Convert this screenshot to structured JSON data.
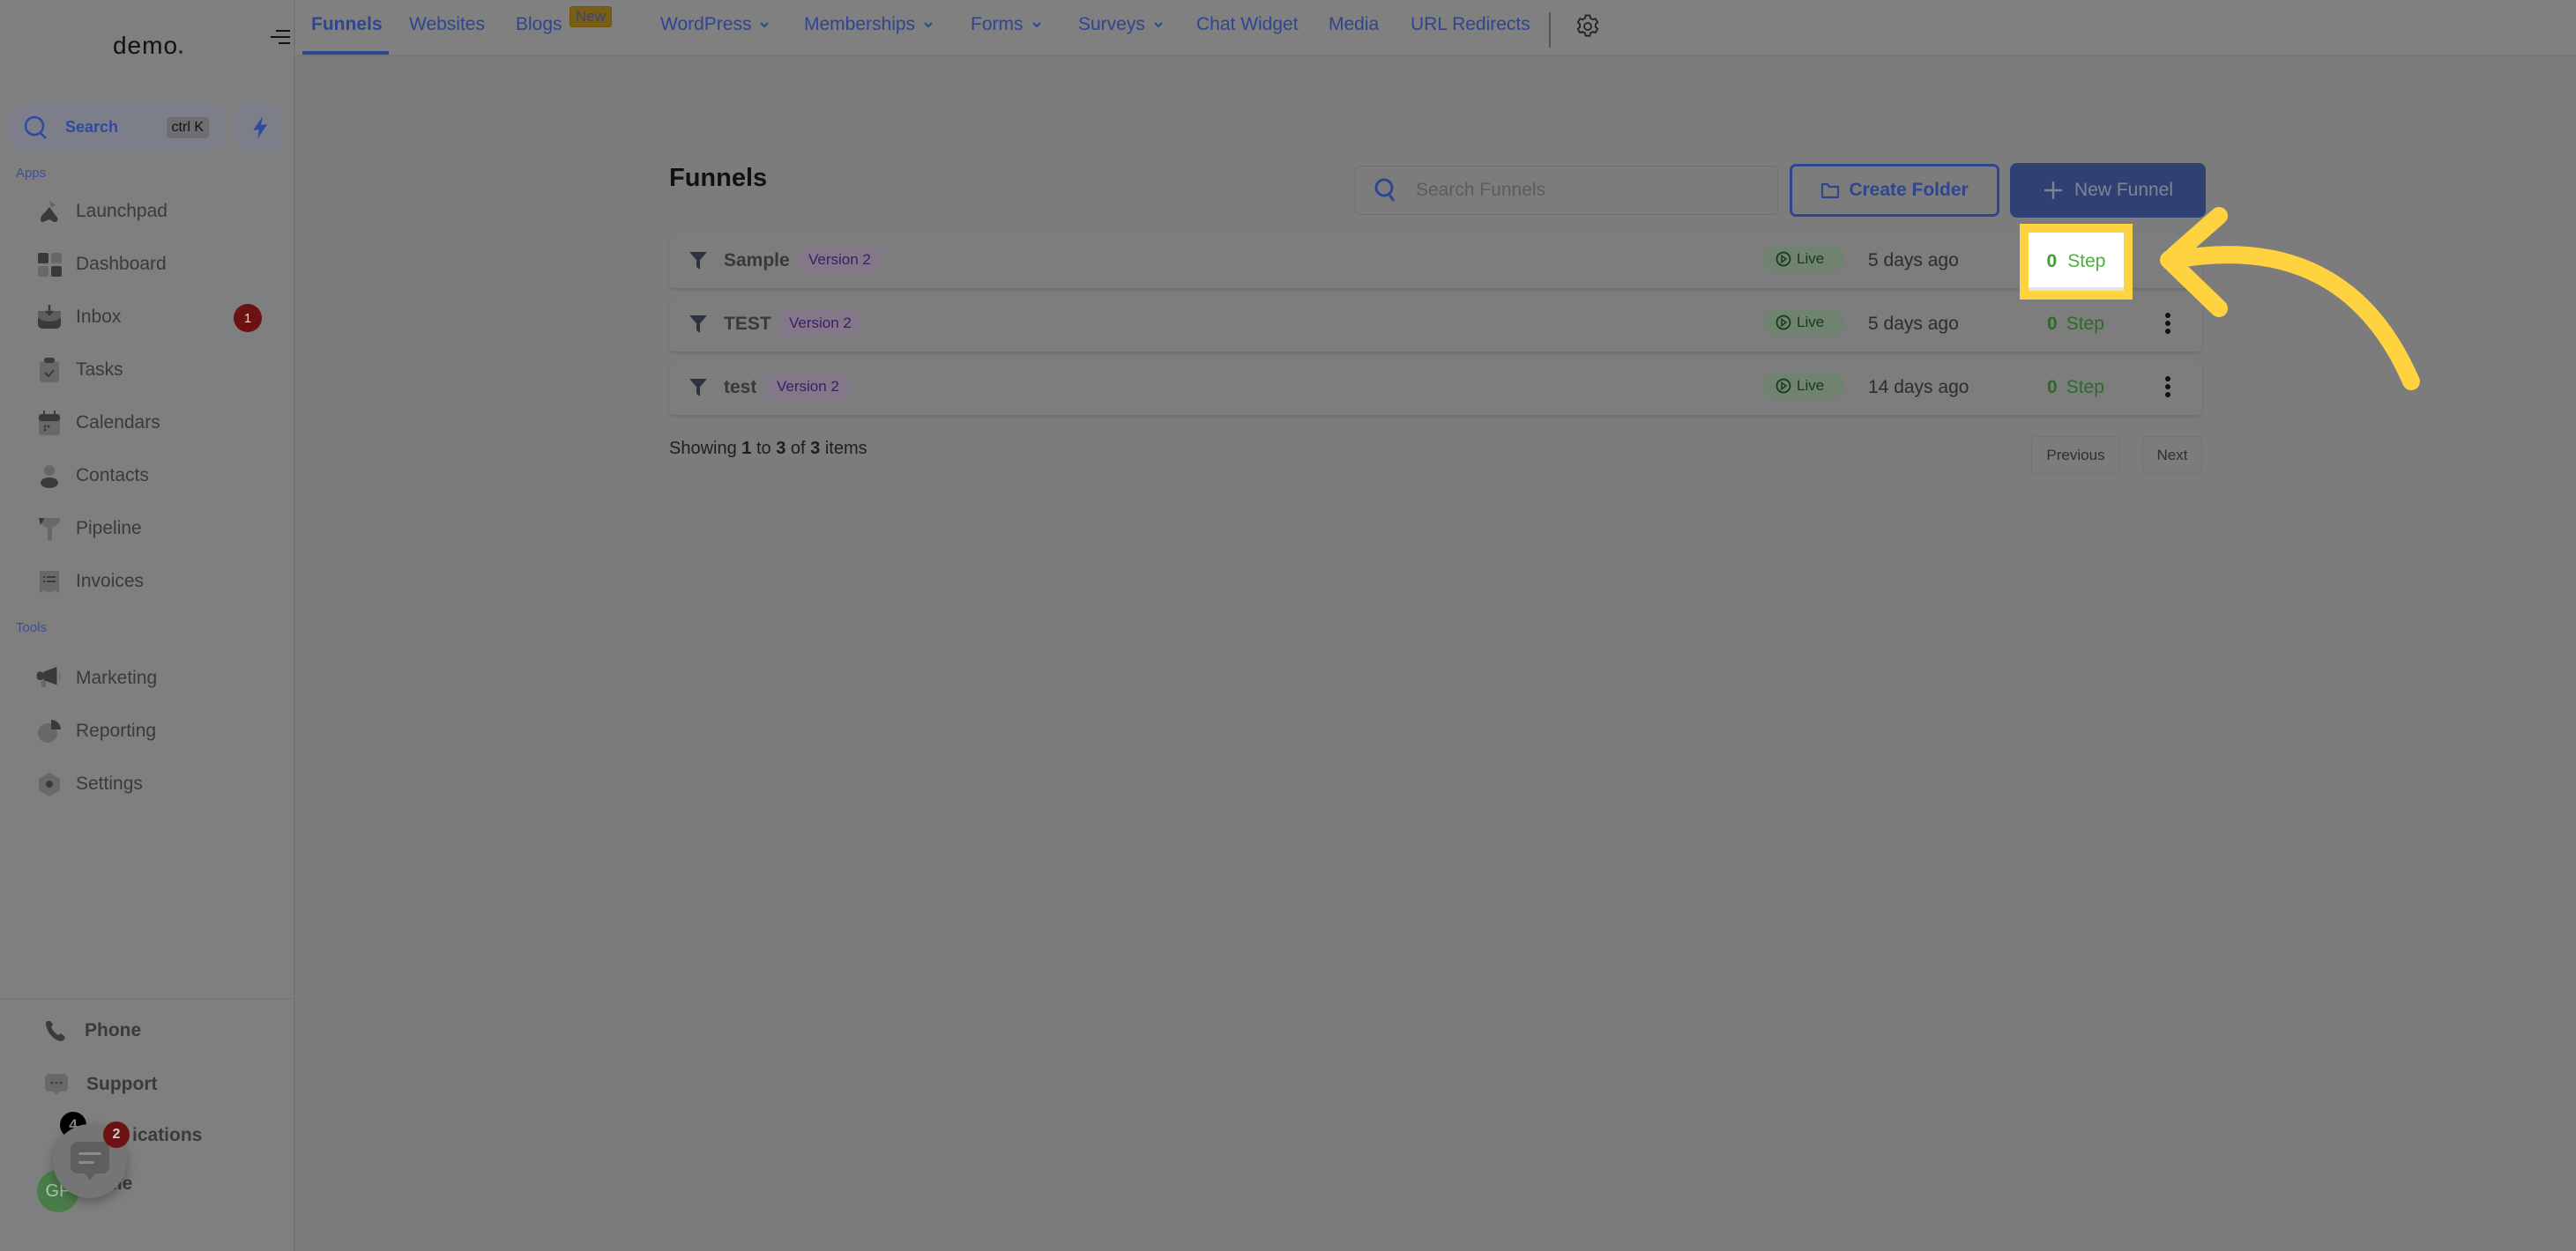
{
  "sidebar": {
    "logo": "demo",
    "search": {
      "label": "Search",
      "shortcut": "ctrl K"
    },
    "apps_label": "Apps",
    "tools_label": "Tools",
    "apps": [
      {
        "label": "Launchpad",
        "icon": "launchpad-icon"
      },
      {
        "label": "Dashboard",
        "icon": "dashboard-icon"
      },
      {
        "label": "Inbox",
        "icon": "inbox-icon",
        "badge": "1"
      },
      {
        "label": "Tasks",
        "icon": "tasks-icon"
      },
      {
        "label": "Calendars",
        "icon": "calendar-icon"
      },
      {
        "label": "Contacts",
        "icon": "contacts-icon"
      },
      {
        "label": "Pipeline",
        "icon": "pipeline-icon"
      },
      {
        "label": "Invoices",
        "icon": "invoices-icon"
      }
    ],
    "tools": [
      {
        "label": "Marketing",
        "icon": "megaphone-icon"
      },
      {
        "label": "Reporting",
        "icon": "pie-chart-icon"
      },
      {
        "label": "Settings",
        "icon": "settings-icon"
      }
    ],
    "bottom": [
      {
        "label": "Phone",
        "icon": "phone-icon"
      },
      {
        "label": "Support",
        "icon": "support-chat-icon"
      },
      {
        "label": "Notifications",
        "visible_text": "ications",
        "badge": "4"
      },
      {
        "label": "Profile",
        "visible_text": "file"
      }
    ],
    "avatar_initials": "GP",
    "chat_fab_badge": "2"
  },
  "topnav": {
    "tabs": [
      {
        "label": "Funnels",
        "active": true
      },
      {
        "label": "Websites"
      },
      {
        "label": "Blogs",
        "badge": "New"
      },
      {
        "label": "WordPress",
        "dropdown": true
      },
      {
        "label": "Memberships",
        "dropdown": true
      },
      {
        "label": "Forms",
        "dropdown": true
      },
      {
        "label": "Surveys",
        "dropdown": true
      },
      {
        "label": "Chat Widget"
      },
      {
        "label": "Media"
      },
      {
        "label": "URL Redirects"
      }
    ]
  },
  "main": {
    "title": "Funnels",
    "search_placeholder": "Search Funnels",
    "create_folder_label": "Create Folder",
    "new_funnel_label": "New Funnel",
    "rows": [
      {
        "name": "Sample",
        "version": "Version 2",
        "status": "Live",
        "updated": "5 days ago",
        "steps_count": "0",
        "steps_label": "Step",
        "highlighted": true
      },
      {
        "name": "TEST",
        "version": "Version 2",
        "status": "Live",
        "updated": "5 days ago",
        "steps_count": "0",
        "steps_label": "Step"
      },
      {
        "name": "test",
        "version": "Version 2",
        "status": "Live",
        "updated": "14 days ago",
        "steps_count": "0",
        "steps_label": "Step"
      }
    ],
    "pagination": {
      "prefix": "Showing",
      "from": "1",
      "to_word": "to",
      "to": "3",
      "of_word": "of",
      "total": "3",
      "suffix": "items",
      "previous_label": "Previous",
      "next_label": "Next"
    }
  },
  "annotation": {
    "color": "#ffd23f",
    "target": "Sample row step count"
  },
  "colors": {
    "accent": "#2e4590",
    "step_green": "#4caf3d",
    "live_green": "#1a3a1a",
    "version_purple": "#3e1a6b",
    "badge_red": "#6c1212"
  }
}
